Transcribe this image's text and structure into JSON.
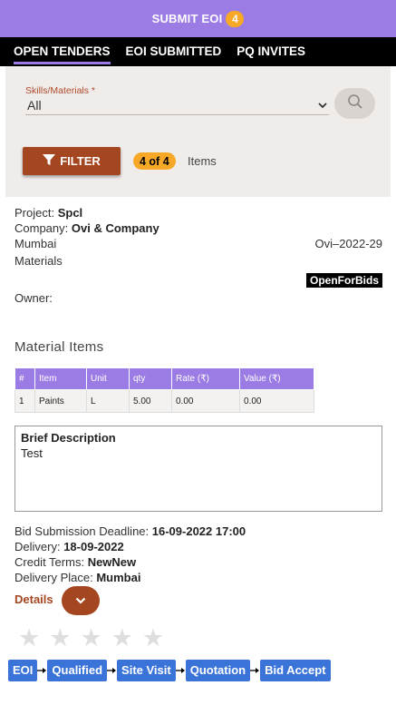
{
  "header": {
    "title": "SUBMIT EOI",
    "badge": "4"
  },
  "tabs": [
    {
      "label": "OPEN TENDERS",
      "active": true
    },
    {
      "label": "EOI SUBMITTED",
      "active": false
    },
    {
      "label": "PQ INVITES",
      "active": false
    }
  ],
  "filter": {
    "skills_label": "Skills/Materials *",
    "skills_value": "All",
    "filter_button": "FILTER",
    "count_badge": "4 of 4",
    "items_label": "Items"
  },
  "tender": {
    "project_label": "Project:",
    "project_value": "Spcl",
    "company_label": "Company:",
    "company_value": "Ovi & Company",
    "city": "Mumbai",
    "ref": "Ovi–2022-29",
    "category": "Materials",
    "status": "OpenForBids",
    "owner_label": "Owner:",
    "section_title": "Material Items",
    "table": {
      "headers": [
        "#",
        "Item",
        "Unit",
        "qty",
        "Rate (₹)",
        "Value (₹)"
      ],
      "rows": [
        [
          "1",
          "Paints",
          "L",
          "5.00",
          "0.00",
          "0.00"
        ]
      ]
    },
    "brief_title": "Brief Description",
    "brief_text": "Test",
    "deadline_label": "Bid Submission Deadline:",
    "deadline_value": "16-09-2022 17:00",
    "delivery_label": "Delivery:",
    "delivery_value": "18-09-2022",
    "credit_label": "Credit Terms:",
    "credit_value": "NewNew",
    "place_label": "Delivery Place:",
    "place_value": "Mumbai",
    "details_label": "Details",
    "rating": 0,
    "workflow": [
      "EOI",
      "Qualified",
      "Site Visit",
      "Quotation",
      "Bid Accept"
    ]
  },
  "colors": {
    "accent_purple": "#9b7be4",
    "brand_brown": "#a4461f",
    "badge_orange": "#f7a826",
    "step_blue": "#3b74d9"
  }
}
